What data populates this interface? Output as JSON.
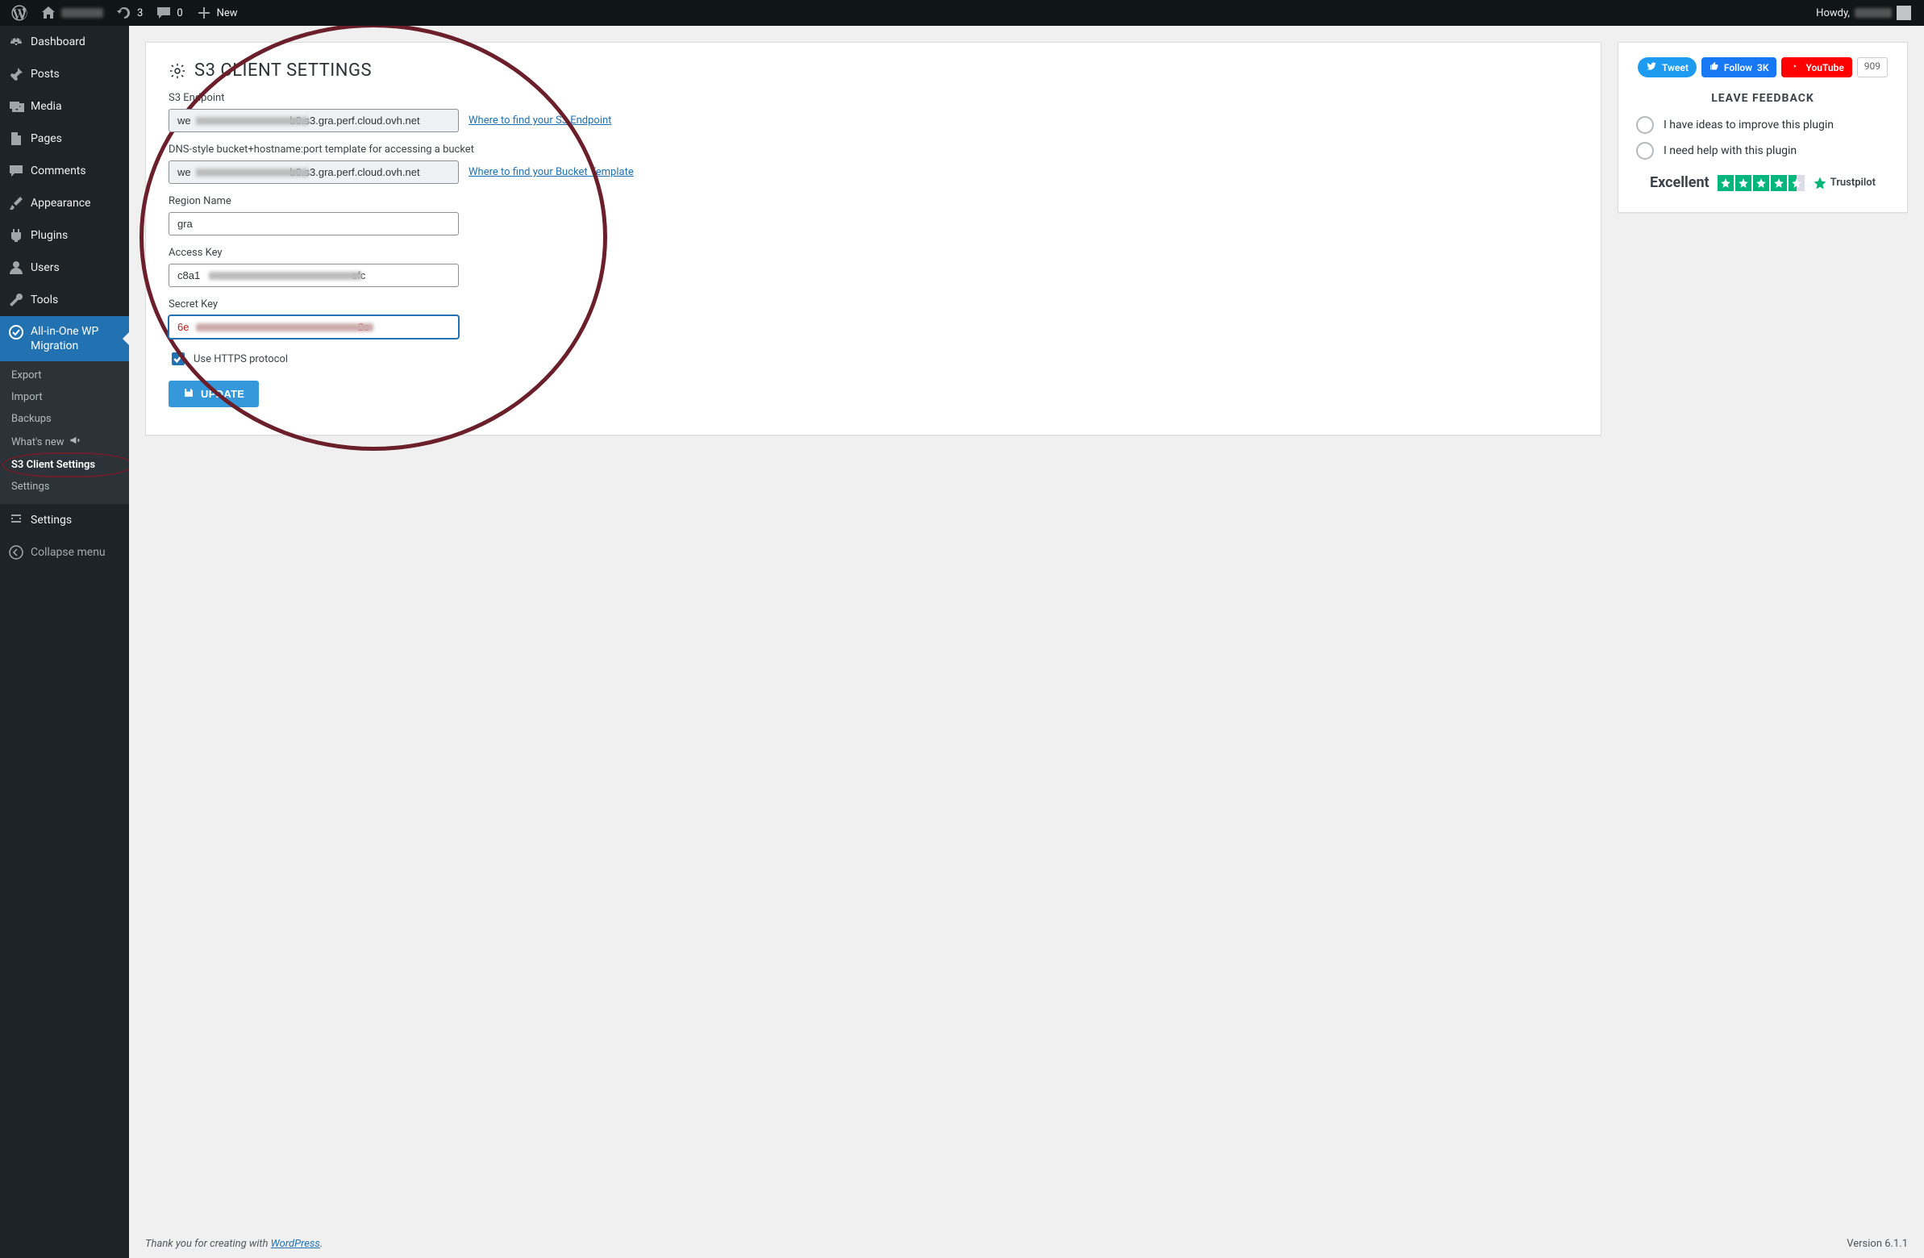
{
  "adminbar": {
    "notif_count": "3",
    "comments_count": "0",
    "new_label": "New",
    "howdy_prefix": "Howdy,"
  },
  "sidebar": {
    "items": [
      {
        "id": "dashboard",
        "label": "Dashboard"
      },
      {
        "id": "posts",
        "label": "Posts"
      },
      {
        "id": "media",
        "label": "Media"
      },
      {
        "id": "pages",
        "label": "Pages"
      },
      {
        "id": "comments",
        "label": "Comments"
      },
      {
        "id": "appearance",
        "label": "Appearance"
      },
      {
        "id": "plugins",
        "label": "Plugins"
      },
      {
        "id": "users",
        "label": "Users"
      },
      {
        "id": "tools",
        "label": "Tools"
      },
      {
        "id": "ai1wm",
        "label": "All-in-One WP Migration"
      },
      {
        "id": "settings",
        "label": "Settings"
      },
      {
        "id": "collapse",
        "label": "Collapse menu"
      }
    ],
    "ai1wm_sub": [
      {
        "id": "export",
        "label": "Export"
      },
      {
        "id": "import",
        "label": "Import"
      },
      {
        "id": "backups",
        "label": "Backups"
      },
      {
        "id": "whatsnew",
        "label": "What's new"
      },
      {
        "id": "s3client",
        "label": "S3 Client Settings"
      },
      {
        "id": "ai1settings",
        "label": "Settings"
      }
    ]
  },
  "page": {
    "title": "S3 CLIENT SETTINGS",
    "fields": {
      "endpoint_label": "S3 Endpoint",
      "endpoint_value": "we                                  b0.s3.gra.perf.cloud.ovh.net",
      "endpoint_help": "Where to find your S3 Endpoint",
      "template_label": "DNS-style bucket+hostname:port template for accessing a bucket",
      "template_value": "we                                  b0.s3.gra.perf.cloud.ovh.net",
      "template_help": "Where to find your Bucket Template",
      "region_label": "Region Name",
      "region_value": "gra",
      "access_label": "Access Key",
      "access_value": "c8a1                                                    efc",
      "secret_label": "Secret Key",
      "secret_value": "6e                                                          2c",
      "https_label": "Use HTTPS protocol",
      "https_checked": true
    },
    "update_label": "UPDATE"
  },
  "side": {
    "tweet_label": "Tweet",
    "fb_follow_label": "Follow",
    "fb_follow_count": "3K",
    "yt_label": "YouTube",
    "yt_count": "909",
    "feedback_heading": "LEAVE FEEDBACK",
    "fb1": "I have ideas to improve this plugin",
    "fb2": "I need help with this plugin",
    "trust_word": "Excellent",
    "trust_brand": "Trustpilot"
  },
  "footer": {
    "thanks_prefix": "Thank you for creating with ",
    "wp_link": "WordPress",
    "thanks_suffix": ".",
    "version": "Version 6.1.1"
  }
}
